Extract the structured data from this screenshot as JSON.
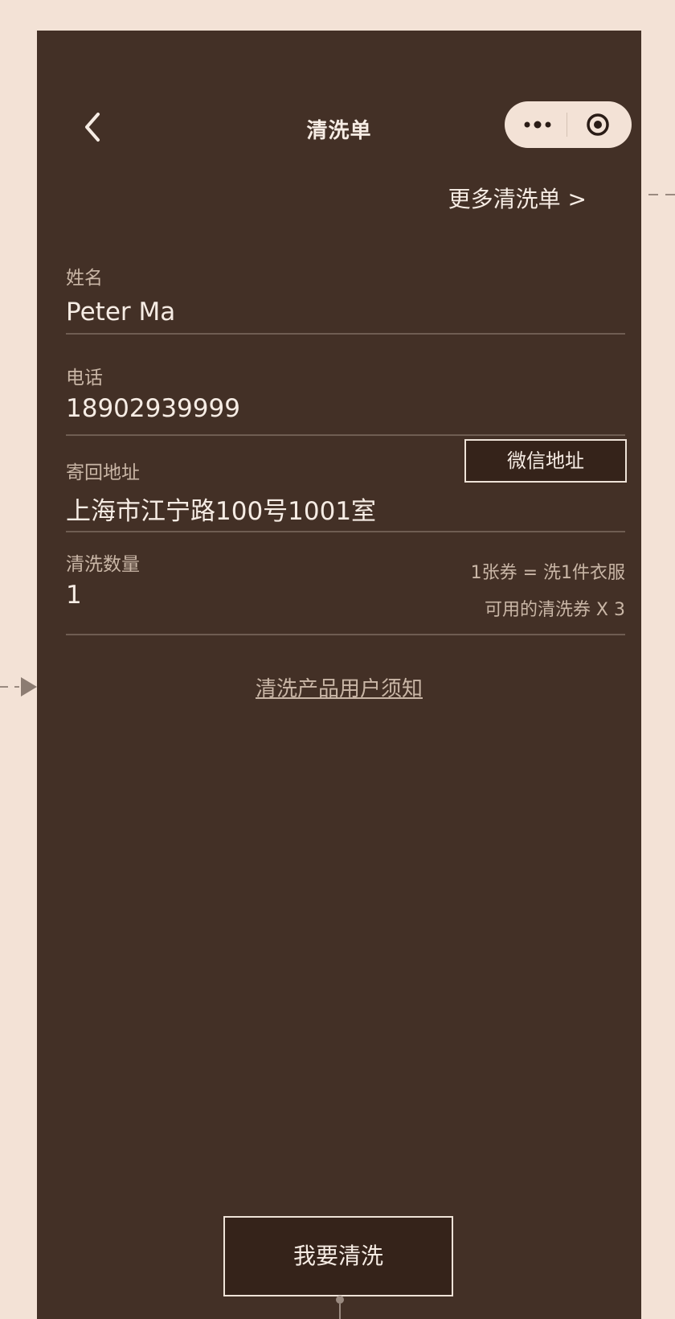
{
  "nav": {
    "title": "清洗单",
    "back_icon": "chevron-left-icon",
    "more_icon": "more-dots-icon",
    "close_icon": "target-circle-icon"
  },
  "more_orders": {
    "label": "更多清洗单 >"
  },
  "form": {
    "name": {
      "label": "姓名",
      "value": "Peter Ma"
    },
    "phone": {
      "label": "电话",
      "value": "18902939999"
    },
    "address": {
      "label": "寄回地址",
      "value": "上海市江宁路100号1001室",
      "wechat_button": "微信地址"
    },
    "quantity": {
      "label": "清洗数量",
      "value": "1",
      "rule_hint": "1张券 = 洗1件衣服",
      "available_hint": "可用的清洗券 X 3"
    }
  },
  "notice": {
    "label": "清洗产品用户须知"
  },
  "submit": {
    "label": "我要清洗"
  },
  "colors": {
    "page_background": "#f3e2d6",
    "screen_background": "#433026",
    "button_background": "#35231a",
    "text_primary": "#f6ece4",
    "text_secondary": "#c9b6a6",
    "annotation": "#9a8a80"
  }
}
